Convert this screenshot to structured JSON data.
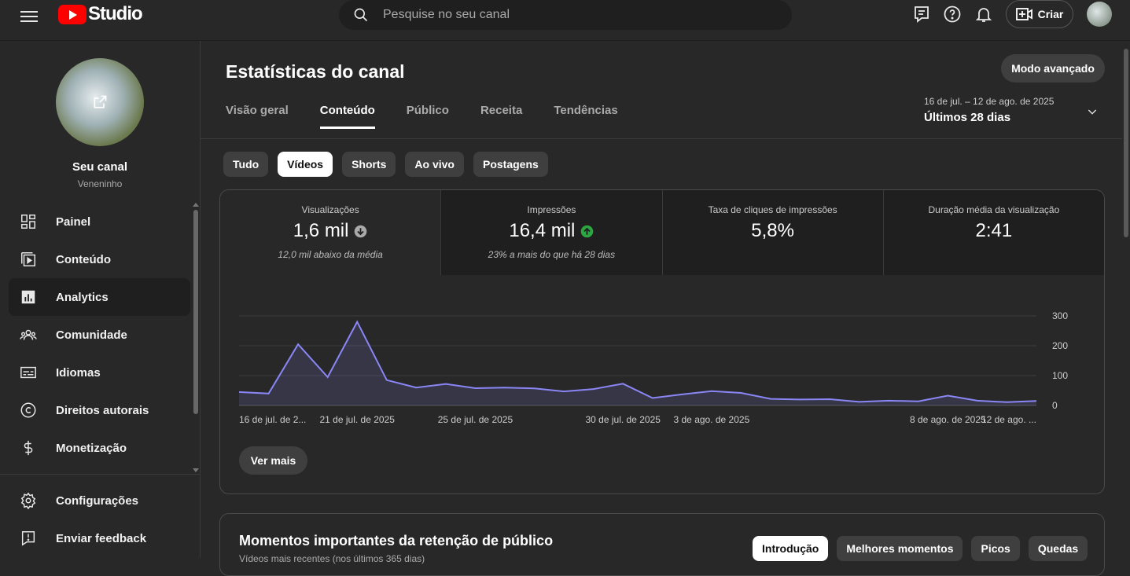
{
  "header": {
    "logo_text": "Studio",
    "search_placeholder": "Pesquise no seu canal",
    "create_label": "Criar"
  },
  "sidebar": {
    "channel_title": "Seu canal",
    "channel_handle": "Veneninho",
    "items": [
      {
        "label": "Painel",
        "icon": "dashboard-icon"
      },
      {
        "label": "Conteúdo",
        "icon": "content-icon"
      },
      {
        "label": "Analytics",
        "icon": "analytics-icon"
      },
      {
        "label": "Comunidade",
        "icon": "community-icon"
      },
      {
        "label": "Idiomas",
        "icon": "subtitles-icon"
      },
      {
        "label": "Direitos autorais",
        "icon": "copyright-icon"
      },
      {
        "label": "Monetização",
        "icon": "dollar-icon"
      }
    ],
    "bottom_items": [
      {
        "label": "Configurações",
        "icon": "settings-icon"
      },
      {
        "label": "Enviar feedback",
        "icon": "feedback-icon"
      }
    ]
  },
  "page": {
    "title": "Estatísticas do canal",
    "advanced_button": "Modo avançado",
    "tabs": [
      "Visão geral",
      "Conteúdo",
      "Público",
      "Receita",
      "Tendências"
    ],
    "date_range": "16 de jul. – 12 de ago. de 2025",
    "date_period": "Últimos 28 dias",
    "chips": [
      "Tudo",
      "Vídeos",
      "Shorts",
      "Ao vivo",
      "Postagens"
    ]
  },
  "metrics": [
    {
      "label": "Visualizações",
      "value": "1,6 mil",
      "sub": "12,0 mil abaixo da média",
      "trend": "down"
    },
    {
      "label": "Impressões",
      "value": "16,4 mil",
      "sub": "23% a mais do que há 28 dias",
      "trend": "up"
    },
    {
      "label": "Taxa de cliques de impressões",
      "value": "5,8%",
      "sub": "",
      "trend": ""
    },
    {
      "label": "Duração média da visualização",
      "value": "2:41",
      "sub": "",
      "trend": ""
    }
  ],
  "colors": {
    "line": "#8a86f5",
    "up": "#2ba640",
    "down": "#aaaaaa"
  },
  "chart_data": {
    "type": "area",
    "x": [
      "16 de jul. de 2025",
      "17 de jul.",
      "18 de jul.",
      "19 de jul.",
      "20 de jul.",
      "21 de jul. de 2025",
      "22 de jul.",
      "23 de jul.",
      "24 de jul.",
      "25 de jul. de 2025",
      "26 de jul.",
      "27 de jul.",
      "28 de jul.",
      "29 de jul.",
      "30 de jul. de 2025",
      "31 de jul.",
      "1 de ago.",
      "2 de ago.",
      "3 de ago. de 2025",
      "4 de ago.",
      "5 de ago.",
      "6 de ago.",
      "7 de ago.",
      "8 de ago. de 2025",
      "9 de ago.",
      "10 de ago.",
      "11 de ago.",
      "12 de ago. de 2025"
    ],
    "values": [
      45,
      40,
      205,
      95,
      280,
      85,
      60,
      72,
      58,
      60,
      57,
      47,
      55,
      73,
      25,
      37,
      48,
      42,
      22,
      20,
      21,
      12,
      16,
      14,
      33,
      16,
      11,
      15
    ],
    "xtick_labels": [
      {
        "index": 0,
        "label": "16 de jul. de 2..."
      },
      {
        "index": 4,
        "label": "21 de jul. de 2025"
      },
      {
        "index": 8,
        "label": "25 de jul. de 2025"
      },
      {
        "index": 13,
        "label": "30 de jul. de 2025"
      },
      {
        "index": 16,
        "label": "3 de ago. de 2025"
      },
      {
        "index": 24,
        "label": "8 de ago. de 2025"
      },
      {
        "index": 27,
        "label": "12 de ago. ..."
      }
    ],
    "yticks": [
      0,
      100,
      200,
      300
    ],
    "ylim": [
      0,
      300
    ],
    "grid": true
  },
  "more_button": "Ver mais",
  "retention": {
    "title": "Momentos importantes da retenção de público",
    "subtitle": "Vídeos mais recentes (nos últimos 365 dias)",
    "chips": [
      "Introdução",
      "Melhores momentos",
      "Picos",
      "Quedas"
    ]
  }
}
